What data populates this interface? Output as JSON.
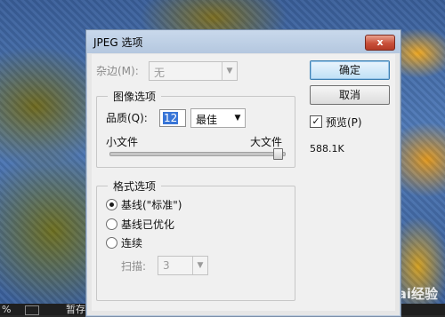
{
  "dialog": {
    "title": "JPEG 选项",
    "close_label": "x"
  },
  "matte": {
    "label": "杂边(M):",
    "value": "无"
  },
  "image_options": {
    "group_title": "图像选项",
    "quality_label": "品质(Q):",
    "quality_value": "12",
    "quality_preset": "最佳",
    "small_file_label": "小文件",
    "large_file_label": "大文件",
    "slider_level": 1.0
  },
  "format_options": {
    "group_title": "格式选项",
    "radio_baseline_standard": "基线(\"标准\")",
    "radio_baseline_optimized": "基线已优化",
    "radio_progressive": "连续",
    "scans_label": "扫描:",
    "scans_value": "3",
    "selected": "baseline_standard"
  },
  "buttons": {
    "ok": "确定",
    "cancel": "取消"
  },
  "preview": {
    "label": "预览(P)",
    "checked": true,
    "size": "588.1K"
  },
  "statusbar": {
    "zoom": "%",
    "save_text": "暂存"
  },
  "watermark": "Bai经验"
}
